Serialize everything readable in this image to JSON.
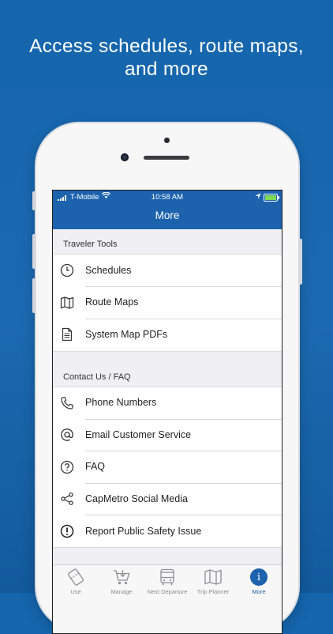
{
  "headline": {
    "line1": "Access schedules, route maps,",
    "line2": "and more"
  },
  "status": {
    "carrier": "T-Mobile",
    "time": "10:58 AM"
  },
  "nav": {
    "title": "More"
  },
  "sections": [
    {
      "header": "Traveler Tools",
      "items": [
        {
          "label": "Schedules",
          "icon": "clock-icon"
        },
        {
          "label": "Route Maps",
          "icon": "map-icon"
        },
        {
          "label": "System Map PDFs",
          "icon": "document-icon"
        }
      ]
    },
    {
      "header": "Contact Us / FAQ",
      "items": [
        {
          "label": "Phone Numbers",
          "icon": "phone-icon"
        },
        {
          "label": "Email Customer Service",
          "icon": "at-sign-icon"
        },
        {
          "label": "FAQ",
          "icon": "question-icon"
        },
        {
          "label": "CapMetro Social Media",
          "icon": "share-icon"
        },
        {
          "label": "Report Public Safety Issue",
          "icon": "exclamation-icon"
        }
      ]
    }
  ],
  "tabs": [
    {
      "label": "Use",
      "icon": "ticket-icon"
    },
    {
      "label": "Manage",
      "icon": "cart-icon"
    },
    {
      "label": "Next Departure",
      "icon": "bus-icon"
    },
    {
      "label": "Trip Planner",
      "icon": "map-icon"
    },
    {
      "label": "More",
      "icon": "info-icon"
    }
  ],
  "colors": {
    "brand": "#1c62ad",
    "background": "#1565ad",
    "active_tab": "#1c62ad",
    "inactive_tab": "#8e8e93",
    "battery_charge": "#7ed957"
  }
}
